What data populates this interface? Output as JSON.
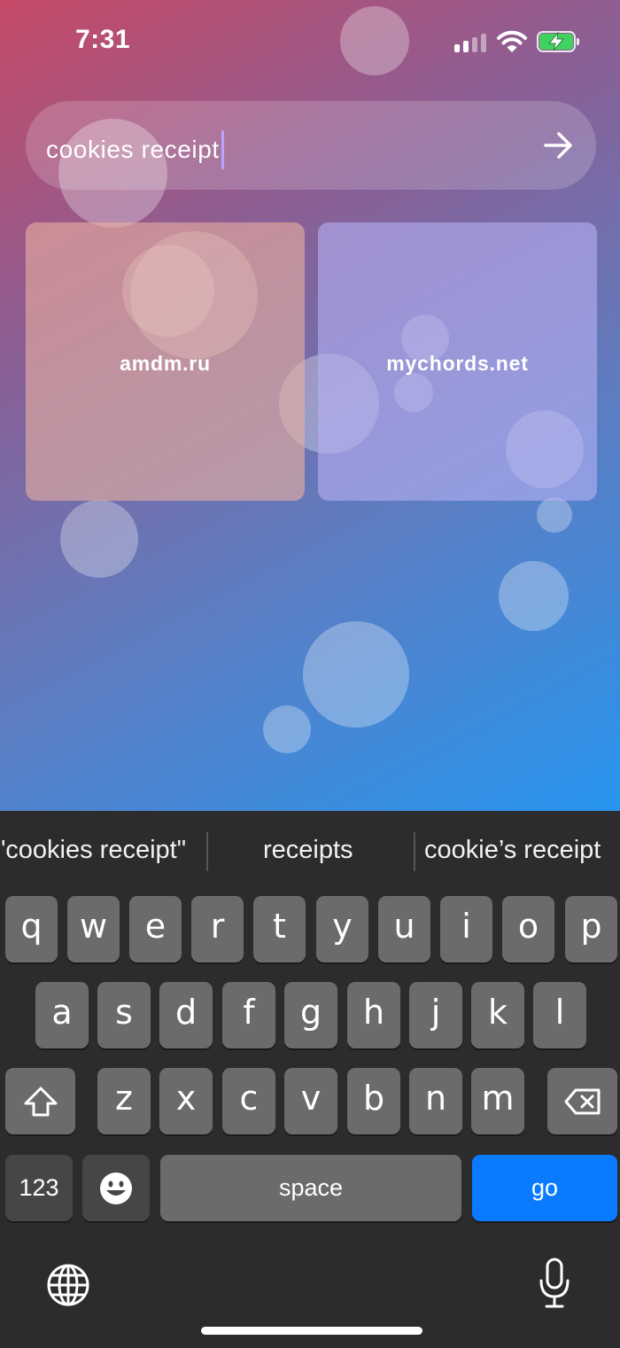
{
  "status": {
    "time": "7:31",
    "signal_icon": "cellular-signal-icon",
    "wifi_icon": "wifi-icon",
    "battery_icon": "battery-charging-icon"
  },
  "search": {
    "value": "cookies receipt",
    "go_icon": "arrow-right-icon"
  },
  "tiles": [
    {
      "label": "amdm.ru"
    },
    {
      "label": "mychords.net"
    }
  ],
  "keyboard": {
    "suggestions": [
      "\"cookies receipt\"",
      "receipts",
      "cookie’s receipt"
    ],
    "row1": [
      "q",
      "w",
      "e",
      "r",
      "t",
      "y",
      "u",
      "i",
      "o",
      "p"
    ],
    "row2": [
      "a",
      "s",
      "d",
      "f",
      "g",
      "h",
      "j",
      "k",
      "l"
    ],
    "row3": [
      "z",
      "x",
      "c",
      "v",
      "b",
      "n",
      "m"
    ],
    "numbers_label": "123",
    "space_label": "space",
    "go_label": "go",
    "accent_color": "#0a7bff"
  }
}
